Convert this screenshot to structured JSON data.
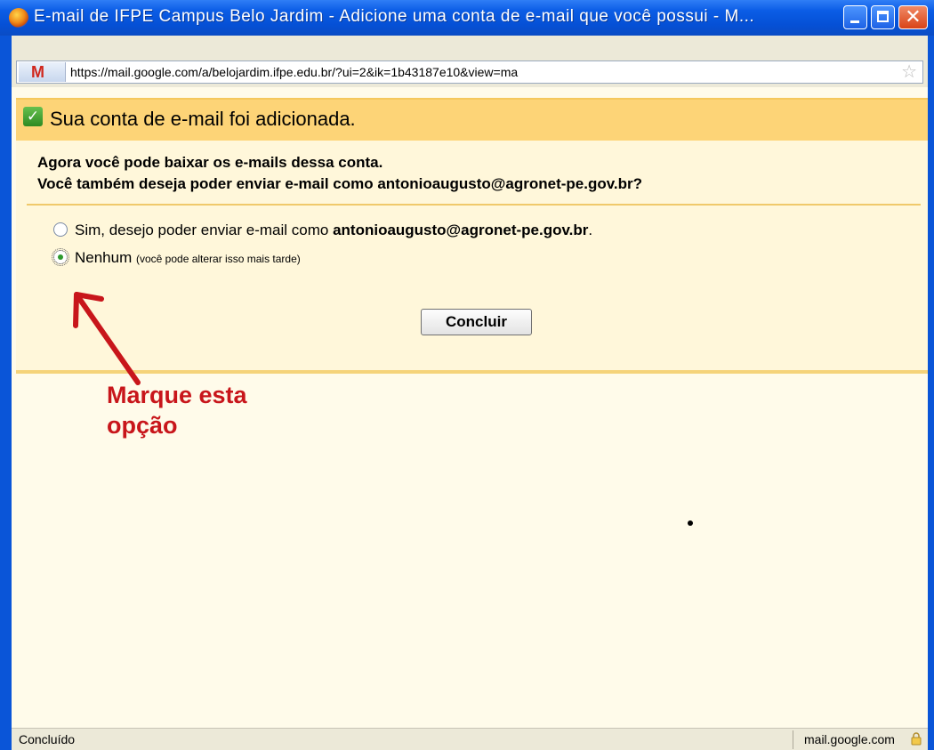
{
  "window": {
    "title": "E-mail de IFPE Campus Belo Jardim - Adicione uma conta de e-mail que você possui - M...",
    "url": "https://mail.google.com/a/belojardim.ifpe.edu.br/?ui=2&ik=1b43187e10&view=ma",
    "close_glyph": "✕"
  },
  "panel": {
    "banner": "Sua conta de e-mail foi adicionada.",
    "question_line1": "Agora você pode baixar os e-mails dessa conta.",
    "question_line2": "Você também deseja poder enviar e-mail como antonioaugusto@agronet-pe.gov.br?",
    "option_yes_prefix": "Sim, desejo poder enviar e-mail como ",
    "option_yes_email": "antonioaugusto@agronet-pe.gov.br",
    "option_yes_suffix": ".",
    "option_none_label": "Nenhum",
    "option_none_hint": "(você pode alterar isso mais tarde)",
    "selected_option": "none",
    "submit_label": "Concluir"
  },
  "annotation": {
    "line1": "Marque esta",
    "line2": "opção",
    "color": "#c8161b"
  },
  "status": {
    "left": "Concluído",
    "right": "mail.google.com"
  },
  "icons": {
    "browser": "firefox-icon",
    "site": "gmail-m-icon",
    "bookmark": "star-icon",
    "success": "check-icon",
    "secure": "lock-icon"
  }
}
